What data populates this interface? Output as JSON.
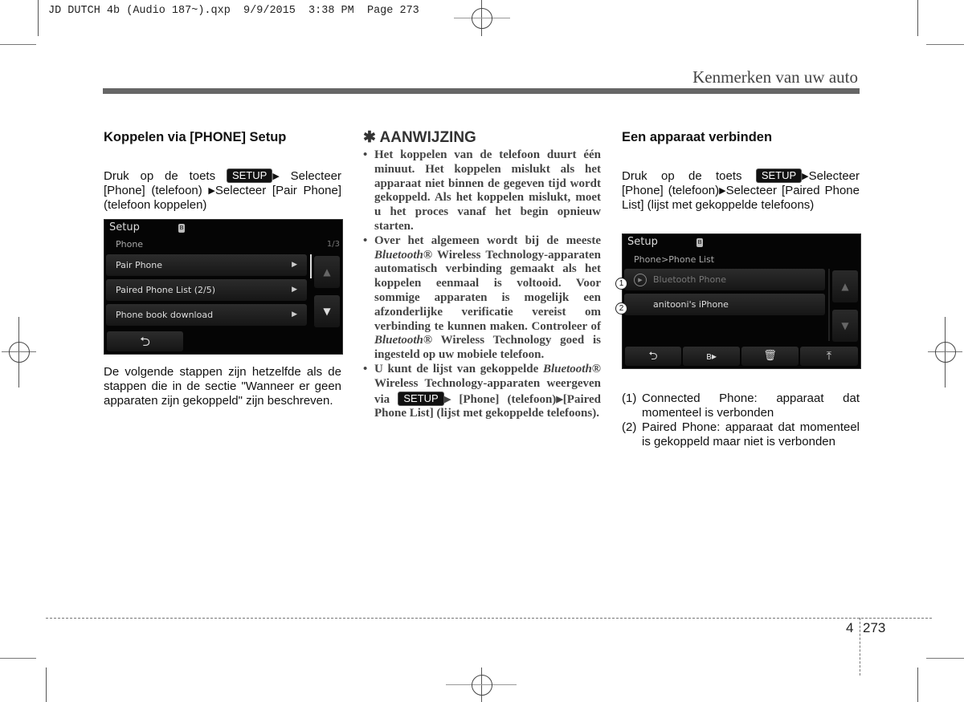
{
  "print_slug": "JD DUTCH 4b (Audio 187~).qxp  9/9/2015  3:38 PM  Page 273",
  "header": {
    "title": "Kenmerken van uw auto"
  },
  "left_column": {
    "heading": "Koppelen via [PHONE] Setup",
    "instruction": {
      "part1": "Druk op de toets",
      "button": "SETUP",
      "part2": "Selecteer [Phone] (telefoon)",
      "part3": "Selecteer [Pair Phone] (telefoon koppelen)"
    },
    "screen": {
      "title": "Setup",
      "subtitle": "Phone",
      "page_indicator": "1/3",
      "items": [
        {
          "label": "Pair Phone",
          "arrow": "▶"
        },
        {
          "label": "Paired Phone List  (2/5)",
          "arrow": "▶"
        },
        {
          "label": "Phone book download",
          "arrow": "▶"
        }
      ],
      "up_icon": "▲",
      "down_icon": "▼",
      "back_icon": "⮌"
    },
    "paragraph": "De volgende stappen zijn hetzelfde als de stappen die in de sectie \"Wanneer er geen apparaten zijn gekoppeld\" zijn beschreven."
  },
  "note": {
    "icon": "✱",
    "title": "AANWIJZING",
    "bullets": [
      {
        "text": "Het koppelen van de telefoon duurt één minuut. Het koppelen mislukt als het apparaat niet binnen de gegeven tijd wordt gekoppeld. Als het koppelen mislukt, moet u het proces vanaf het begin opnieuw starten."
      },
      {
        "t1": "Over het algemeen wordt bij de meeste ",
        "i1": "Bluetooth®",
        "t2": " Wireless Technology-apparaten automatisch verbinding gemaakt als het koppelen eenmaal is voltooid. Voor sommige apparaten is mogelijk een afzonderlijke verificatie vereist om verbinding te kunnen maken. Controleer of ",
        "i2": "Bluetooth®",
        "t3": " Wireless Technology goed is ingesteld op uw mobiele telefoon."
      },
      {
        "t1": "U kunt de lijst van gekoppelde ",
        "i1": "Bluetooth®",
        "t2": " Wireless Technology-apparaten weergeven via ",
        "button": "SETUP",
        "t3": "[Phone] (telefoon)",
        "t4": "[Paired Phone List] (lijst met gekoppelde telefoons)."
      }
    ]
  },
  "right_column": {
    "heading": "Een apparaat verbinden",
    "instruction": {
      "part1": "Druk op de toets",
      "button": "SETUP",
      "part2": "Selecteer [Phone] (telefoon)",
      "part3": "Selecteer [Paired Phone List] (lijst met gekoppelde telefoons)"
    },
    "screen": {
      "title": "Setup",
      "breadcrumb": "Phone>Phone List",
      "items": [
        {
          "marker": "1",
          "label": "Bluetooth Phone",
          "icon": "▶"
        },
        {
          "marker": "2",
          "label": "anitooni's iPhone"
        }
      ],
      "toolbar": [
        "⮌",
        "ʙ▸",
        "🗑",
        "⤒"
      ],
      "up_icon": "▲",
      "down_icon": "▼"
    },
    "legend": [
      {
        "num": "(1)",
        "text": "Connected Phone: apparaat dat momenteel is verbonden"
      },
      {
        "num": "(2)",
        "text": "Paired Phone: apparaat dat momenteel is gekoppeld maar niet is verbonden"
      }
    ]
  },
  "footer": {
    "chapter": "4",
    "page": "273"
  }
}
